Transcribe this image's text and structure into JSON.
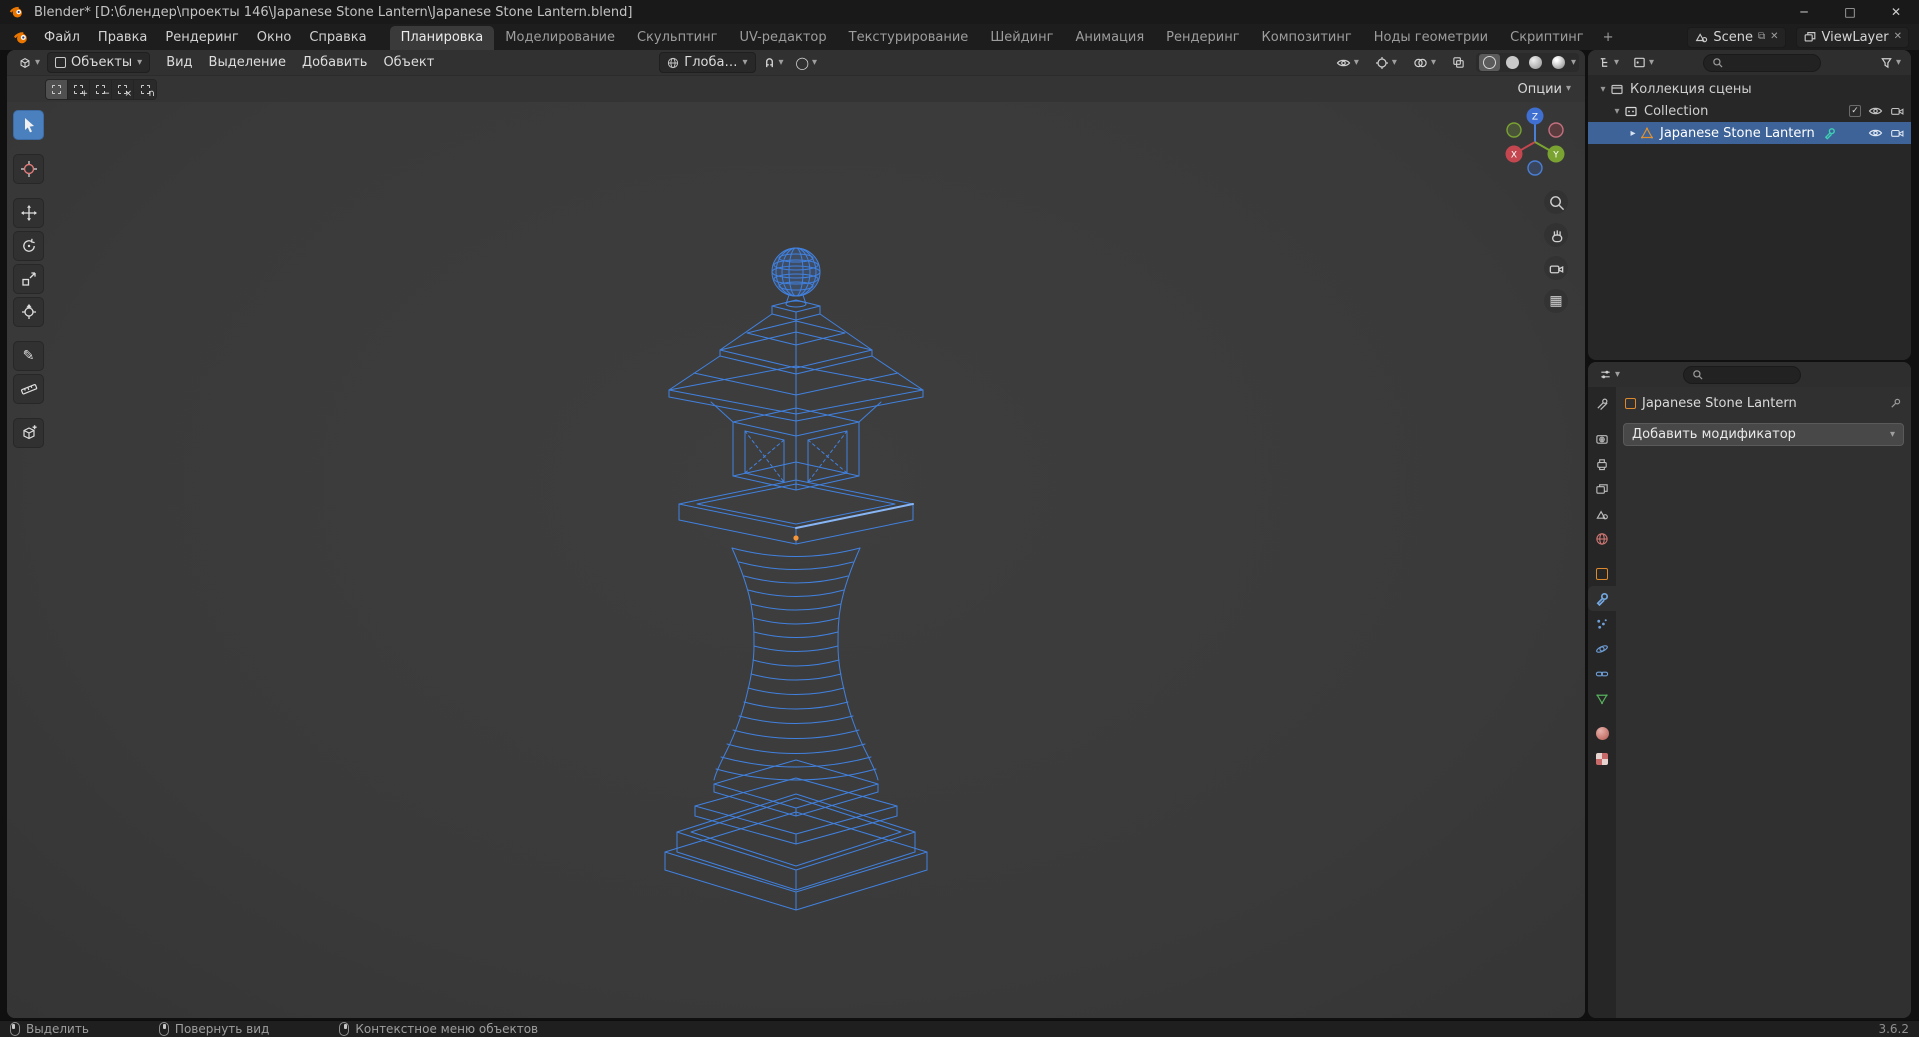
{
  "window": {
    "title": "Blender* [D:\\блендер\\проекты 146\\Japanese Stone Lantern\\Japanese Stone Lantern.blend]"
  },
  "icons": {
    "minimize": "─",
    "maximize": "□",
    "close": "✕",
    "chevron_down": "▾",
    "disclosure_open": "▾",
    "disclosure_closed": "▸",
    "check": "✓",
    "annotate_pen": "✎",
    "grid": "▦",
    "prop_circle": "◯",
    "mode_extend": "+",
    "mode_subtract": "−",
    "mode_invert": "×",
    "mode_intersect": "∩",
    "unlink": "✕",
    "add_tab": "+"
  },
  "menubar": {
    "menus": [
      "Файл",
      "Правка",
      "Рендеринг",
      "Окно",
      "Справка"
    ],
    "workspaces": [
      "Планировка",
      "Моделирование",
      "Скульптинг",
      "UV-редактор",
      "Текстурирование",
      "Шейдинг",
      "Анимация",
      "Рендеринг",
      "Композитинг",
      "Ноды геометрии",
      "Скриптинг"
    ],
    "active_workspace": "Планировка",
    "scene_label": "Scene",
    "view_layer_label": "ViewLayer"
  },
  "viewport": {
    "mode_label": "Объекты",
    "menus": [
      "Вид",
      "Выделение",
      "Добавить",
      "Объект"
    ],
    "orientation_label": "Глоба…",
    "options_label": "Опции",
    "axis": {
      "x": "X",
      "y": "Y",
      "z": "Z"
    },
    "shading_modes": [
      "wireframe",
      "solid",
      "material",
      "rendered"
    ],
    "active_shading": "wireframe",
    "active_tool": "select-box"
  },
  "outliner": {
    "rows": [
      {
        "label": "Коллекция сцены",
        "icon": "scene-collection"
      },
      {
        "label": "Collection",
        "icon": "collection"
      },
      {
        "label": "Japanese Stone Lantern",
        "icon": "mesh-object",
        "selected": true
      }
    ]
  },
  "properties": {
    "object_name": "Japanese Stone Lantern",
    "add_modifier_label": "Добавить модификатор",
    "active_tab": "modifiers",
    "tabs": [
      "tool",
      "render",
      "output",
      "view-layer",
      "scene",
      "world",
      "object",
      "modifiers",
      "particles",
      "physics",
      "constraints",
      "data",
      "material",
      "texture"
    ]
  },
  "statusbar": {
    "hints": [
      "Выделить",
      "Повернуть вид",
      "Контекстное меню объектов"
    ],
    "version": "3.6.2"
  },
  "colors": {
    "accent": "#4772b3",
    "wireframe_blue": "#4285e8",
    "selected_row": "#3d6399",
    "object_orange": "#dd8a2e",
    "mesh_green": "#4cbf8e",
    "shading_red": "#c96a6a",
    "viewport_bg": "#3b3b3b"
  }
}
